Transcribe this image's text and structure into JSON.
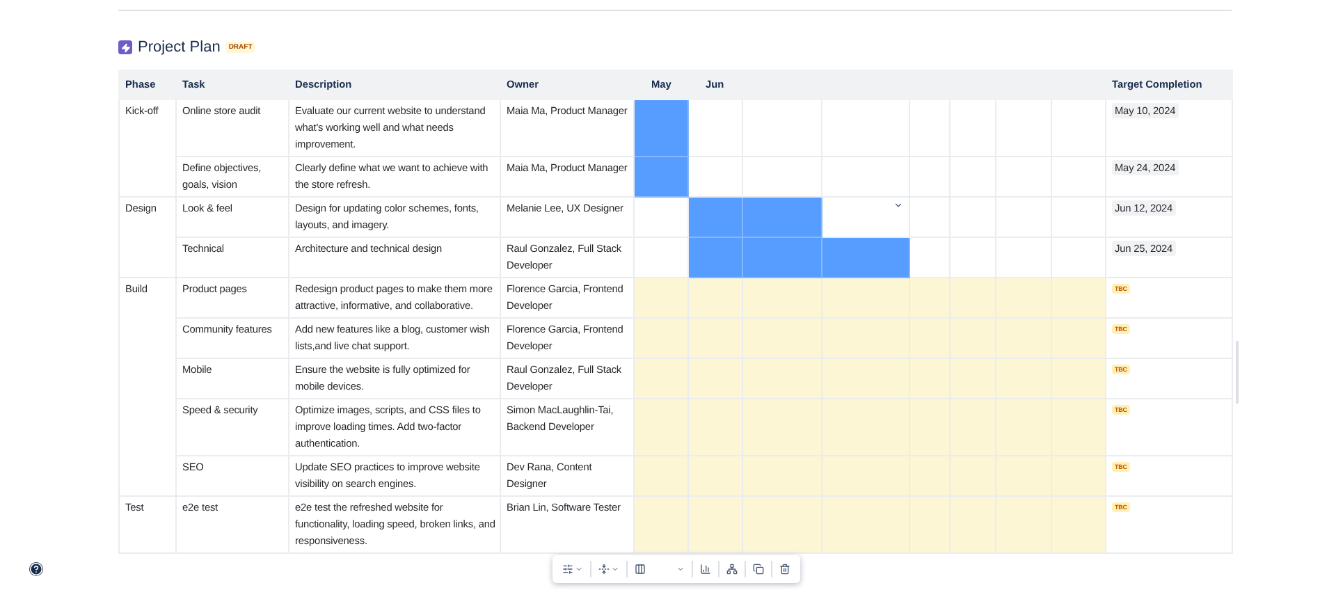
{
  "page": {
    "title": "Project Plan",
    "status": "DRAFT"
  },
  "table": {
    "columns": [
      "Phase",
      "Task",
      "Description",
      "Owner"
    ],
    "months": [
      "May",
      "Jun"
    ],
    "target_column": "Target Completion",
    "phases": [
      {
        "name": "Kick-off",
        "tasks": [
          {
            "task": "Online store audit",
            "description": "Evaluate our current website to understand what's working well and what needs improvement.",
            "owner": "Maia Ma, Product Manager",
            "timeline": [
              {
                "kind": "scheduled"
              },
              {
                "kind": "none"
              },
              {
                "kind": "none"
              },
              {
                "kind": "none"
              },
              {
                "kind": "none"
              },
              {
                "kind": "none"
              },
              {
                "kind": "none"
              },
              {
                "kind": "none"
              }
            ],
            "target": {
              "kind": "date",
              "text": "May 10, 2024"
            }
          },
          {
            "task": "Define objectives, goals, vision",
            "description": "Clearly define what we want to achieve with the store refresh.",
            "owner": "Maia Ma, Product Manager",
            "timeline": [
              {
                "kind": "scheduled"
              },
              {
                "kind": "none"
              },
              {
                "kind": "none"
              },
              {
                "kind": "none"
              },
              {
                "kind": "none"
              },
              {
                "kind": "none"
              },
              {
                "kind": "none"
              },
              {
                "kind": "none"
              }
            ],
            "target": {
              "kind": "date",
              "text": "May 24, 2024"
            }
          }
        ]
      },
      {
        "name": "Design",
        "tasks": [
          {
            "task": "Look & feel",
            "description": "Design for updating color schemes, fonts, layouts, and imagery.",
            "owner": "Melanie Lee, UX Designer",
            "timeline": [
              {
                "kind": "none"
              },
              {
                "kind": "scheduled"
              },
              {
                "kind": "scheduled"
              },
              {
                "kind": "none"
              },
              {
                "kind": "none"
              },
              {
                "kind": "none"
              },
              {
                "kind": "none"
              },
              {
                "kind": "none"
              }
            ],
            "target": {
              "kind": "date",
              "text": "Jun 12, 2024"
            }
          },
          {
            "task": "Technical",
            "description": "Architecture and technical design",
            "owner": "Raul Gonzalez, Full Stack Developer",
            "timeline": [
              {
                "kind": "none"
              },
              {
                "kind": "scheduled"
              },
              {
                "kind": "scheduled"
              },
              {
                "kind": "scheduled"
              },
              {
                "kind": "none"
              },
              {
                "kind": "none"
              },
              {
                "kind": "none"
              },
              {
                "kind": "none"
              }
            ],
            "target": {
              "kind": "date",
              "text": "Jun 25, 2024"
            }
          }
        ]
      },
      {
        "name": "Build",
        "tasks": [
          {
            "task": "Product pages",
            "description": "Redesign product pages to make them more attractive, informative, and collaborative.",
            "owner": "Florence Garcia, Frontend Developer",
            "timeline": [
              {
                "kind": "tentative"
              },
              {
                "kind": "tentative"
              },
              {
                "kind": "tentative"
              },
              {
                "kind": "tentative"
              },
              {
                "kind": "tentative"
              },
              {
                "kind": "tentative"
              },
              {
                "kind": "tentative"
              },
              {
                "kind": "tentative"
              }
            ],
            "target": {
              "kind": "status",
              "text": "TBC"
            }
          },
          {
            "task": "Community features",
            "description": "Add new features like a blog, customer wish lists,and live chat support.",
            "owner": "Florence Garcia, Frontend Developer",
            "timeline": [
              {
                "kind": "tentative"
              },
              {
                "kind": "tentative"
              },
              {
                "kind": "tentative"
              },
              {
                "kind": "tentative"
              },
              {
                "kind": "tentative"
              },
              {
                "kind": "tentative"
              },
              {
                "kind": "tentative"
              },
              {
                "kind": "tentative"
              }
            ],
            "target": {
              "kind": "status",
              "text": "TBC"
            }
          },
          {
            "task": "Mobile",
            "description": "Ensure the website is fully optimized for mobile devices.",
            "owner": "Raul Gonzalez, Full Stack Developer",
            "timeline": [
              {
                "kind": "tentative"
              },
              {
                "kind": "tentative"
              },
              {
                "kind": "tentative"
              },
              {
                "kind": "tentative"
              },
              {
                "kind": "tentative"
              },
              {
                "kind": "tentative"
              },
              {
                "kind": "tentative"
              },
              {
                "kind": "tentative"
              }
            ],
            "target": {
              "kind": "status",
              "text": "TBC"
            }
          },
          {
            "task": "Speed & security",
            "description": "Optimize images, scripts, and CSS files to improve loading times. Add two-factor authentication.",
            "owner": "Simon MacLaughlin-Tai, Backend Developer",
            "timeline": [
              {
                "kind": "tentative"
              },
              {
                "kind": "tentative"
              },
              {
                "kind": "tentative"
              },
              {
                "kind": "tentative"
              },
              {
                "kind": "tentative"
              },
              {
                "kind": "tentative"
              },
              {
                "kind": "tentative"
              },
              {
                "kind": "tentative"
              }
            ],
            "target": {
              "kind": "status",
              "text": "TBC"
            }
          },
          {
            "task": "SEO",
            "description": "Update SEO practices to improve website visibility on search engines.",
            "owner": "Dev Rana, Content Designer",
            "timeline": [
              {
                "kind": "tentative"
              },
              {
                "kind": "tentative"
              },
              {
                "kind": "tentative"
              },
              {
                "kind": "tentative"
              },
              {
                "kind": "tentative"
              },
              {
                "kind": "tentative"
              },
              {
                "kind": "tentative"
              },
              {
                "kind": "tentative"
              }
            ],
            "target": {
              "kind": "status",
              "text": "TBC"
            }
          }
        ]
      },
      {
        "name": "Test",
        "tasks": [
          {
            "task": "e2e test",
            "description": "e2e test the refreshed website for functionality, loading speed, broken links, and responsiveness.",
            "owner": "Brian Lin, Software Tester",
            "timeline": [
              {
                "kind": "tentative"
              },
              {
                "kind": "tentative"
              },
              {
                "kind": "tentative"
              },
              {
                "kind": "tentative"
              },
              {
                "kind": "tentative"
              },
              {
                "kind": "tentative"
              },
              {
                "kind": "tentative"
              },
              {
                "kind": "tentative"
              }
            ],
            "target": {
              "kind": "status",
              "text": "TBC"
            }
          }
        ]
      }
    ]
  }
}
